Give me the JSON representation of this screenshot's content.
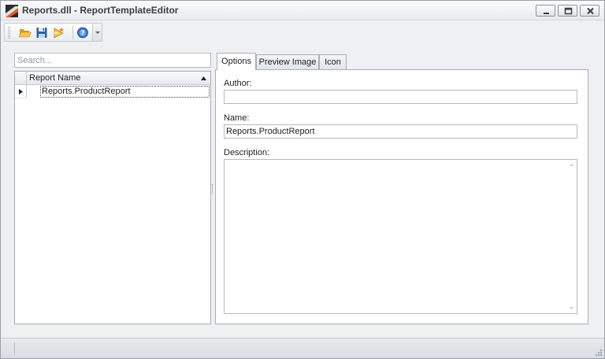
{
  "window": {
    "title": "Reports.dll - ReportTemplateEditor",
    "controls": [
      "minimize-icon",
      "maximize-icon",
      "close-icon"
    ]
  },
  "toolbar": {
    "buttons": [
      {
        "name": "open",
        "icon": "folder-open-icon"
      },
      {
        "name": "save",
        "icon": "floppy-disk-icon"
      },
      {
        "name": "publish",
        "icon": "wand-icon"
      },
      {
        "name": "help",
        "icon": "help-circle-icon"
      }
    ]
  },
  "left_panel": {
    "search": {
      "placeholder": "Search...",
      "value": ""
    },
    "grid": {
      "columns": [
        "Report Name"
      ],
      "sort": "ascending",
      "rows": [
        {
          "report_name": "Reports.ProductReport",
          "selected": true
        }
      ]
    }
  },
  "tabs": [
    {
      "label": "Options",
      "active": true
    },
    {
      "label": "Preview Image",
      "active": false
    },
    {
      "label": "Icon",
      "active": false
    }
  ],
  "options": {
    "author_label": "Author:",
    "author_value": "",
    "name_label": "Name:",
    "name_value": "Reports.ProductReport",
    "description_label": "Description:",
    "description_value": ""
  },
  "colors": {
    "window_background": "#eef0f2",
    "border": "#a9aeb5",
    "help_icon_blue": "#2f6fc7",
    "folder_yellow": "#e9b43a"
  }
}
